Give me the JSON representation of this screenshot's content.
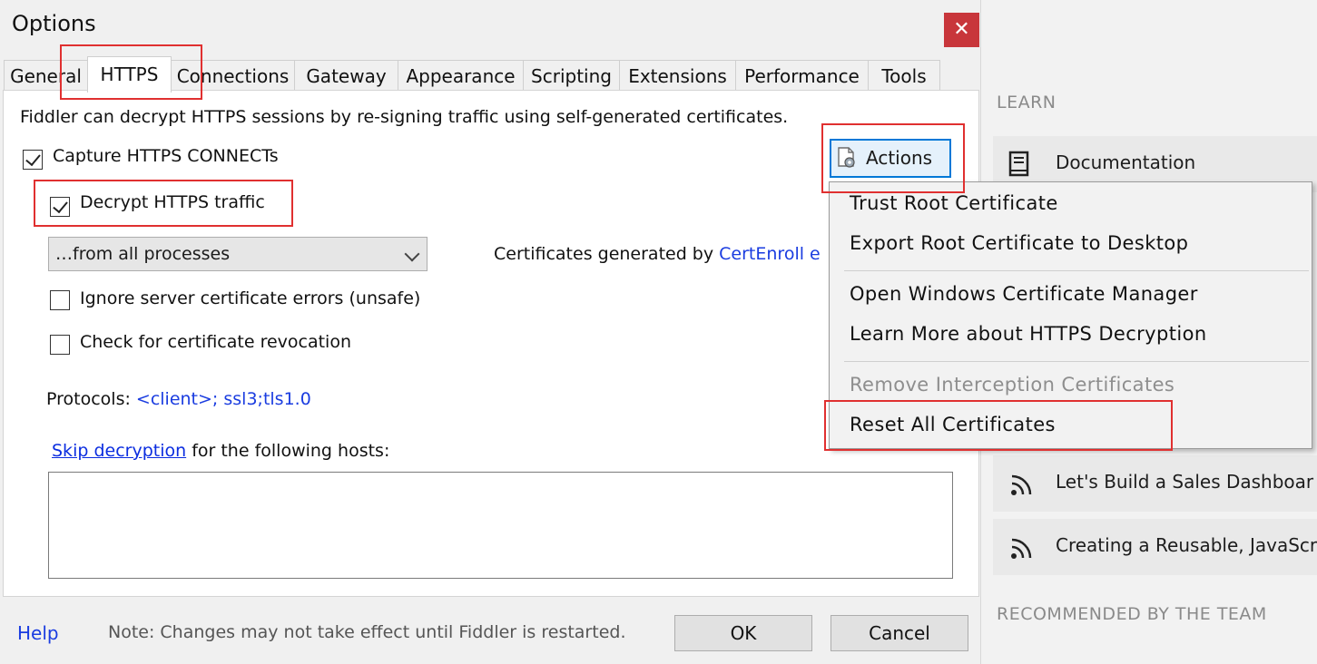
{
  "dialog": {
    "title": "Options",
    "close_glyph": "✕",
    "tabs": [
      {
        "label": "General"
      },
      {
        "label": "HTTPS",
        "active": true
      },
      {
        "label": "Connections"
      },
      {
        "label": "Gateway"
      },
      {
        "label": "Appearance"
      },
      {
        "label": "Scripting"
      },
      {
        "label": "Extensions"
      },
      {
        "label": "Performance"
      },
      {
        "label": "Tools"
      }
    ],
    "description": "Fiddler can decrypt HTTPS sessions by re-signing traffic using self-generated certificates.",
    "capture_connects": {
      "label": "Capture HTTPS CONNECTs",
      "checked": true
    },
    "decrypt_traffic": {
      "label": "Decrypt HTTPS traffic",
      "checked": true
    },
    "process_filter": {
      "value": "…from all processes"
    },
    "certs_generated": {
      "prefix": "Certificates generated by ",
      "engine": "CertEnroll e"
    },
    "ignore_errors": {
      "label": "Ignore server certificate errors (unsafe)",
      "checked": false
    },
    "check_revocation": {
      "label": "Check for certificate revocation",
      "checked": false
    },
    "protocols": {
      "label": "Protocols: ",
      "value": "<client>; ssl3;tls1.0"
    },
    "skip": {
      "link": "Skip decryption",
      "rest": " for the following hosts:"
    },
    "actions_label": "Actions",
    "footer": {
      "help": "Help",
      "note": "Note: Changes may not take effect until Fiddler is restarted.",
      "ok": "OK",
      "cancel": "Cancel"
    }
  },
  "menu": {
    "items": [
      {
        "label": "Trust Root Certificate"
      },
      {
        "label": "Export Root Certificate to Desktop"
      },
      {
        "label": "Open Windows Certificate Manager"
      },
      {
        "label": "Learn More about HTTPS Decryption"
      },
      {
        "label": "Remove Interception Certificates",
        "disabled": true
      },
      {
        "label": "Reset All Certificates"
      }
    ]
  },
  "right_panel": {
    "learn_title": "LEARN",
    "documentation": "Documentation",
    "feed_items": [
      {
        "label": "Let's Build a Sales Dashboar"
      },
      {
        "label": "Creating a Reusable, JavaScr"
      }
    ],
    "recommended_title": "RECOMMENDED BY THE TEAM"
  },
  "colors": {
    "highlight": "#e03030",
    "link": "#1a3ce0",
    "close_button": "#c8363b",
    "actions_border": "#0078d7"
  }
}
